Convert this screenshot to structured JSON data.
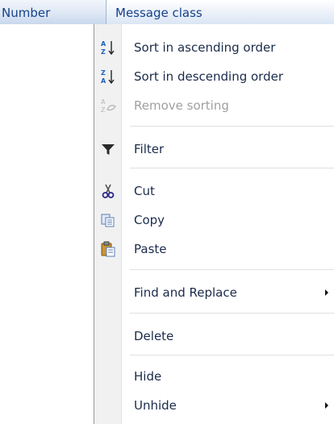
{
  "header": {
    "col_number": "Number",
    "col_message_class": "Message class"
  },
  "menu": {
    "sort_asc": "Sort in ascending order",
    "sort_desc": "Sort in descending order",
    "remove_sorting": "Remove sorting",
    "filter": "Filter",
    "cut": "Cut",
    "copy": "Copy",
    "paste": "Paste",
    "find_replace": "Find and Replace",
    "delete": "Delete",
    "hide": "Hide",
    "unhide": "Unhide"
  },
  "icons": {
    "sort_asc": "sort-ascending-icon",
    "sort_desc": "sort-descending-icon",
    "remove_sorting": "remove-sorting-icon",
    "filter": "filter-funnel-icon",
    "cut": "scissors-icon",
    "copy": "copy-icon",
    "paste": "clipboard-paste-icon"
  },
  "colors": {
    "accent_blue": "#1f5fbf",
    "disabled_text": "#a0a0a0",
    "header_text": "#15428b"
  }
}
